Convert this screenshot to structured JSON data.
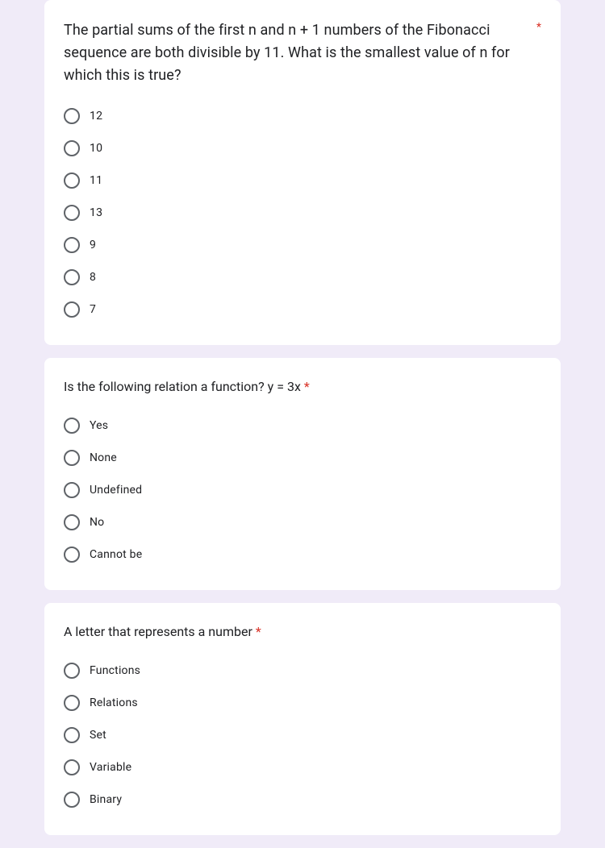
{
  "questions": [
    {
      "text": "The partial sums of the first n and n + 1 numbers of the Fibonacci sequence are both divisible by 11. What is the smallest value of n for which this is true?",
      "required": true,
      "text_size": "large",
      "asterisk_position": "top",
      "options": [
        "12",
        "10",
        "11",
        "13",
        "9",
        "8",
        "7"
      ]
    },
    {
      "text": "Is the following relation a function? y = 3x",
      "required": true,
      "text_size": "small",
      "asterisk_position": "inline",
      "options": [
        "Yes",
        "None",
        "Undefined",
        "No",
        "Cannot be"
      ]
    },
    {
      "text": "A letter that represents a number",
      "required": true,
      "text_size": "small",
      "asterisk_position": "inline_tight",
      "options": [
        "Functions",
        "Relations",
        "Set",
        "Variable",
        "Binary"
      ]
    }
  ]
}
